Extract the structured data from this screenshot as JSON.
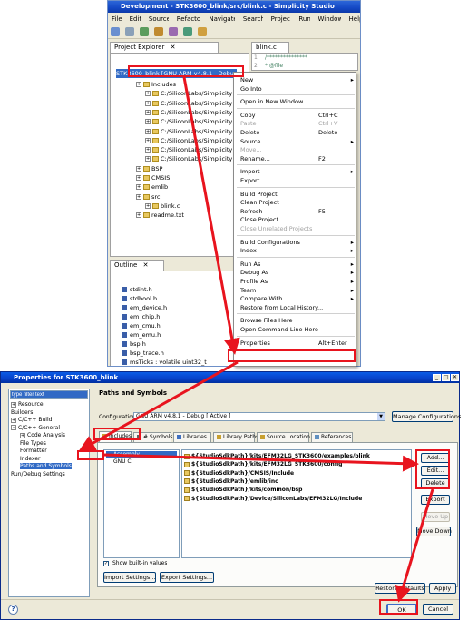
{
  "ide": {
    "title": "Development - STK3600_blink/src/blink.c - Simplicity Studio",
    "menu": [
      "File",
      "Edit",
      "Source",
      "Refactor",
      "Navigate",
      "Search",
      "Project",
      "Run",
      "Window",
      "Help"
    ],
    "project_explorer_tab": "Project Explorer",
    "editor_tab": "blink.c",
    "editor_lines": [
      "1",
      "2"
    ],
    "editor_text": [
      "/***************",
      " * @file"
    ],
    "project_label": "STK3600_blink [GNU ARM v4.8.1 - Debu",
    "tree": [
      {
        "label": "Includes",
        "indent": 1
      },
      {
        "label": "C:/SiliconLabs/Simplicity",
        "indent": 2
      },
      {
        "label": "C:/SiliconLabs/Simplicity",
        "indent": 2
      },
      {
        "label": "C:/SiliconLabs/Simplicity",
        "indent": 2
      },
      {
        "label": "C:/SiliconLabs/Simplicity",
        "indent": 2
      },
      {
        "label": "C:/SiliconLabs/Simplicity",
        "indent": 2
      },
      {
        "label": "C:/SiliconLabs/Simplicity",
        "indent": 2
      },
      {
        "label": "C:/SiliconLabs/Simplicity",
        "indent": 2
      },
      {
        "label": "C:/SiliconLabs/Simplicity",
        "indent": 2
      },
      {
        "label": "BSP",
        "indent": 1
      },
      {
        "label": "CMSIS",
        "indent": 1
      },
      {
        "label": "emlib",
        "indent": 1
      },
      {
        "label": "src",
        "indent": 1
      },
      {
        "label": "blink.c",
        "indent": 2
      },
      {
        "label": "readme.txt",
        "indent": 1
      }
    ],
    "outline_tab": "Outline",
    "outline_items": [
      "stdint.h",
      "stdbool.h",
      "em_device.h",
      "em_chip.h",
      "em_cmu.h",
      "em_emu.h",
      "bsp.h",
      "bsp_trace.h",
      "msTicks : volatile uint32_t"
    ],
    "context_menu": {
      "items": [
        {
          "label": "New",
          "arrow": true
        },
        {
          "label": "Go Into"
        },
        {
          "sep": true
        },
        {
          "label": "Open in New Window"
        },
        {
          "sep": true
        },
        {
          "label": "Copy",
          "key": "Ctrl+C"
        },
        {
          "label": "Paste",
          "key": "Ctrl+V",
          "disabled": true
        },
        {
          "label": "Delete",
          "key": "Delete"
        },
        {
          "label": "Source",
          "arrow": true
        },
        {
          "label": "Move...",
          "disabled": true
        },
        {
          "label": "Rename...",
          "key": "F2"
        },
        {
          "sep": true
        },
        {
          "label": "Import",
          "arrow": true
        },
        {
          "label": "Export..."
        },
        {
          "sep": true
        },
        {
          "label": "Build Project"
        },
        {
          "label": "Clean Project"
        },
        {
          "label": "Refresh",
          "key": "F5"
        },
        {
          "label": "Close Project"
        },
        {
          "label": "Close Unrelated Projects",
          "disabled": true
        },
        {
          "sep": true
        },
        {
          "label": "Build Configurations",
          "arrow": true
        },
        {
          "label": "Index",
          "arrow": true
        },
        {
          "sep": true
        },
        {
          "label": "Run As",
          "arrow": true
        },
        {
          "label": "Debug As",
          "arrow": true
        },
        {
          "label": "Profile As",
          "arrow": true
        },
        {
          "label": "Team",
          "arrow": true
        },
        {
          "label": "Compare With",
          "arrow": true
        },
        {
          "label": "Restore from Local History..."
        },
        {
          "sep": true
        },
        {
          "label": "Browse Files Here"
        },
        {
          "label": "Open Command Line Here"
        },
        {
          "sep": true
        },
        {
          "label": "Properties",
          "key": "Alt+Enter"
        }
      ]
    }
  },
  "dialog": {
    "title": "Properties for STK3600_blink",
    "filter_placeholder": "type filter text",
    "nav": [
      {
        "label": "Resource",
        "indent": 0,
        "pm": "+"
      },
      {
        "label": "Builders",
        "indent": 0
      },
      {
        "label": "C/C++ Build",
        "indent": 0,
        "pm": "+"
      },
      {
        "label": "C/C++ General",
        "indent": 0,
        "pm": "-"
      },
      {
        "label": "Code Analysis",
        "indent": 1,
        "pm": "+"
      },
      {
        "label": "File Types",
        "indent": 1
      },
      {
        "label": "Formatter",
        "indent": 1
      },
      {
        "label": "Indexer",
        "indent": 1
      },
      {
        "label": "Paths and Symbols",
        "indent": 1,
        "selected": true
      },
      {
        "label": "Run/Debug Settings",
        "indent": 0
      }
    ],
    "heading": "Paths and Symbols",
    "configuration_label": "Configuration:",
    "configuration_value": "GNU ARM v4.8.1 - Debug  [ Active ]",
    "manage_button": "Manage Configurations...",
    "tabs": [
      "Includes",
      "# Symbols",
      "Libraries",
      "Library Paths",
      "Source Location",
      "References"
    ],
    "languages": [
      "Assembly",
      "GNU C"
    ],
    "paths": [
      "${StudioSdkPath}/kits/EFM32LG_STK3600/examples/blink",
      "${StudioSdkPath}/kits/EFM32LG_STK3600/config",
      "${StudioSdkPath}/CMSIS/Include",
      "${StudioSdkPath}/emlib/inc",
      "${StudioSdkPath}/kits/common/bsp",
      "${StudioSdkPath}/Device/SiliconLabs/EFM32LG/Include"
    ],
    "buttons": {
      "add": "Add...",
      "edit": "Edit...",
      "delete": "Delete",
      "export": "Export",
      "move_up": "Move Up",
      "move_down": "Move Down"
    },
    "show_builtin": "Show built-in values",
    "import_settings": "Import Settings...",
    "export_settings": "Export Settings...",
    "restore_defaults": "Restore Defaults",
    "apply": "Apply",
    "ok": "OK",
    "cancel": "Cancel",
    "help": "?"
  },
  "colors": {
    "highlight": "#e8141e",
    "xp_blue": "#0a5ce6",
    "selection": "#316ac5"
  }
}
